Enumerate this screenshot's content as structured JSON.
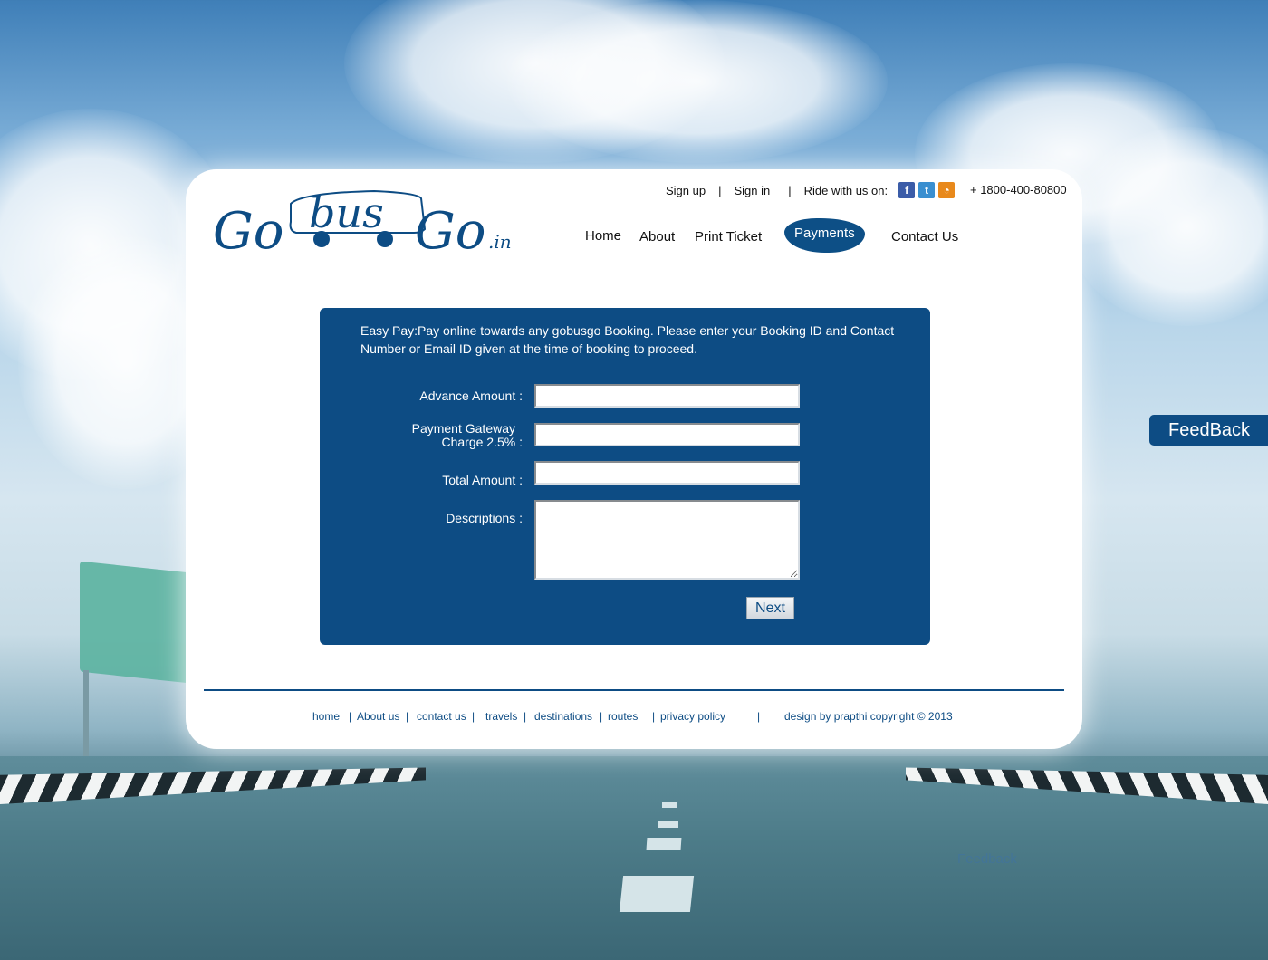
{
  "brand": {
    "logo_go": "Go",
    "logo_bus": "bus",
    "logo_go2": "Go",
    "logo_tld": ".in"
  },
  "toplinks": {
    "signup": "Sign up",
    "signin": "Sign in",
    "ride_label": "Ride with us on:",
    "separator": "|",
    "phone": "+ 1800-400-80800",
    "social": [
      "facebook-icon",
      "twitter-icon",
      "rss-icon"
    ]
  },
  "nav": {
    "home": "Home",
    "about": "About",
    "print_ticket": "Print Ticket",
    "payments": "Payments",
    "contact": "Contact Us",
    "active": "Payments"
  },
  "form": {
    "intro": "Easy Pay:Pay online towards any gobusgo Booking. Please enter your Booking ID and Contact Number or Email ID given at the time of booking to proceed.",
    "advance_label": "Advance Amount :",
    "gateway_label_line1": "Payment Gateway",
    "gateway_label_line2": "Charge 2.5% :",
    "total_label": "Total Amount :",
    "descriptions_label": "Descriptions :",
    "advance_value": "",
    "gateway_value": "",
    "total_value": "",
    "descriptions_value": "",
    "next_label": "Next"
  },
  "footer": {
    "home": "home",
    "about": "About us",
    "contact": "contact us",
    "travels": "travels",
    "destinations": "destinations",
    "routes": "routes",
    "privacy": "privacy policy",
    "sep": "|",
    "credit": "design by prapthi copyright © 2013"
  },
  "feedback_label": "FeedBack",
  "background_link": "Feedback",
  "colors": {
    "brand_blue": "#0d4c84",
    "panel": "#ffffff"
  }
}
